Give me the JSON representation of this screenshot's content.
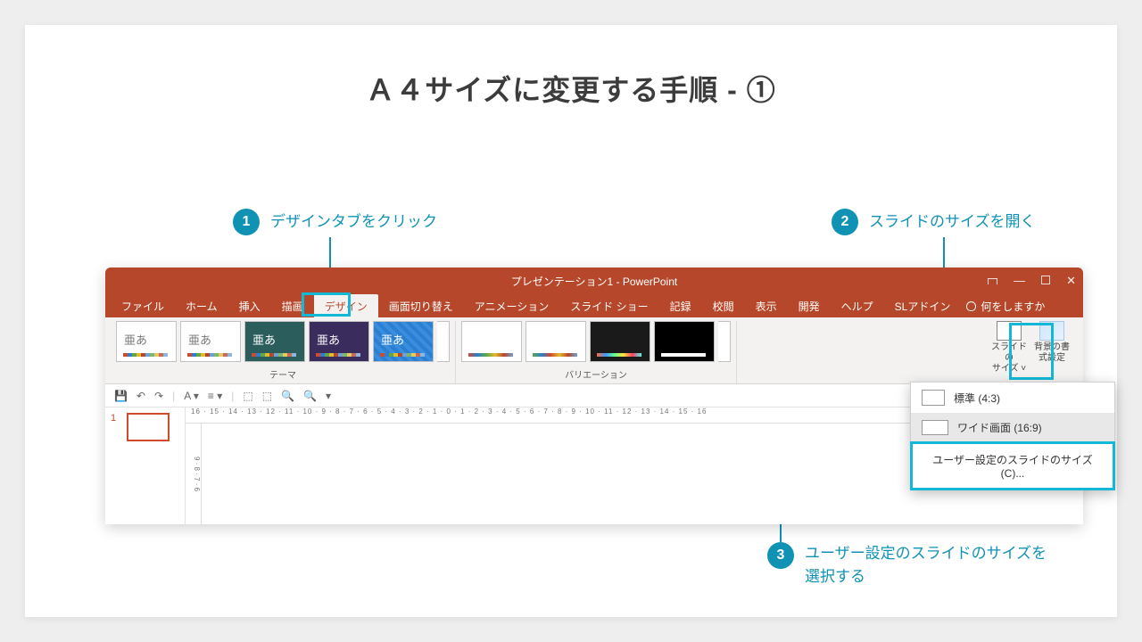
{
  "title": "Ａ４サイズに変更する手順 - ①",
  "annotations": {
    "a1": {
      "num": "1",
      "text": "デザインタブをクリック"
    },
    "a2": {
      "num": "2",
      "text": "スライドのサイズを開く"
    },
    "a3": {
      "num": "3",
      "text": "ユーザー設定のスライドのサイズを\n選択する"
    }
  },
  "window": {
    "title": "プレゼンテーション1 - PowerPoint",
    "tabs": [
      "ファイル",
      "ホーム",
      "挿入",
      "描画",
      "デザイン",
      "画面切り替え",
      "アニメーション",
      "スライド ショー",
      "記録",
      "校閲",
      "表示",
      "開発",
      "ヘルプ",
      "SLアドイン"
    ],
    "active_tab_index": 4,
    "tell_me": "何をしますか",
    "groups": {
      "themes": "テーマ",
      "variants": "バリエーション"
    },
    "theme_glyph": "亜あ",
    "size_btn": "スライドの\nサイズ ˅",
    "bg_btn": "背景の書\n式設定",
    "slide_num": "1",
    "ruler": "16 · 15 · 14 · 13 · 12 · 11 · 10 · 9 · 8 · 7 · 6 · 5 · 4 · 3 · 2 · 1 · 0 · 1 · 2 · 3 · 4 · 5 · 6 · 7 · 8 · 9 · 10 · 11 · 12 · 13 · 14 · 15 · 16",
    "ruler_v": "9 · 8 · 7 · 6"
  },
  "dropdown": {
    "std": "標準 (4:3)",
    "wide": "ワイド画面 (16:9)",
    "custom": "ユーザー設定のスライドのサイズ(C)..."
  }
}
